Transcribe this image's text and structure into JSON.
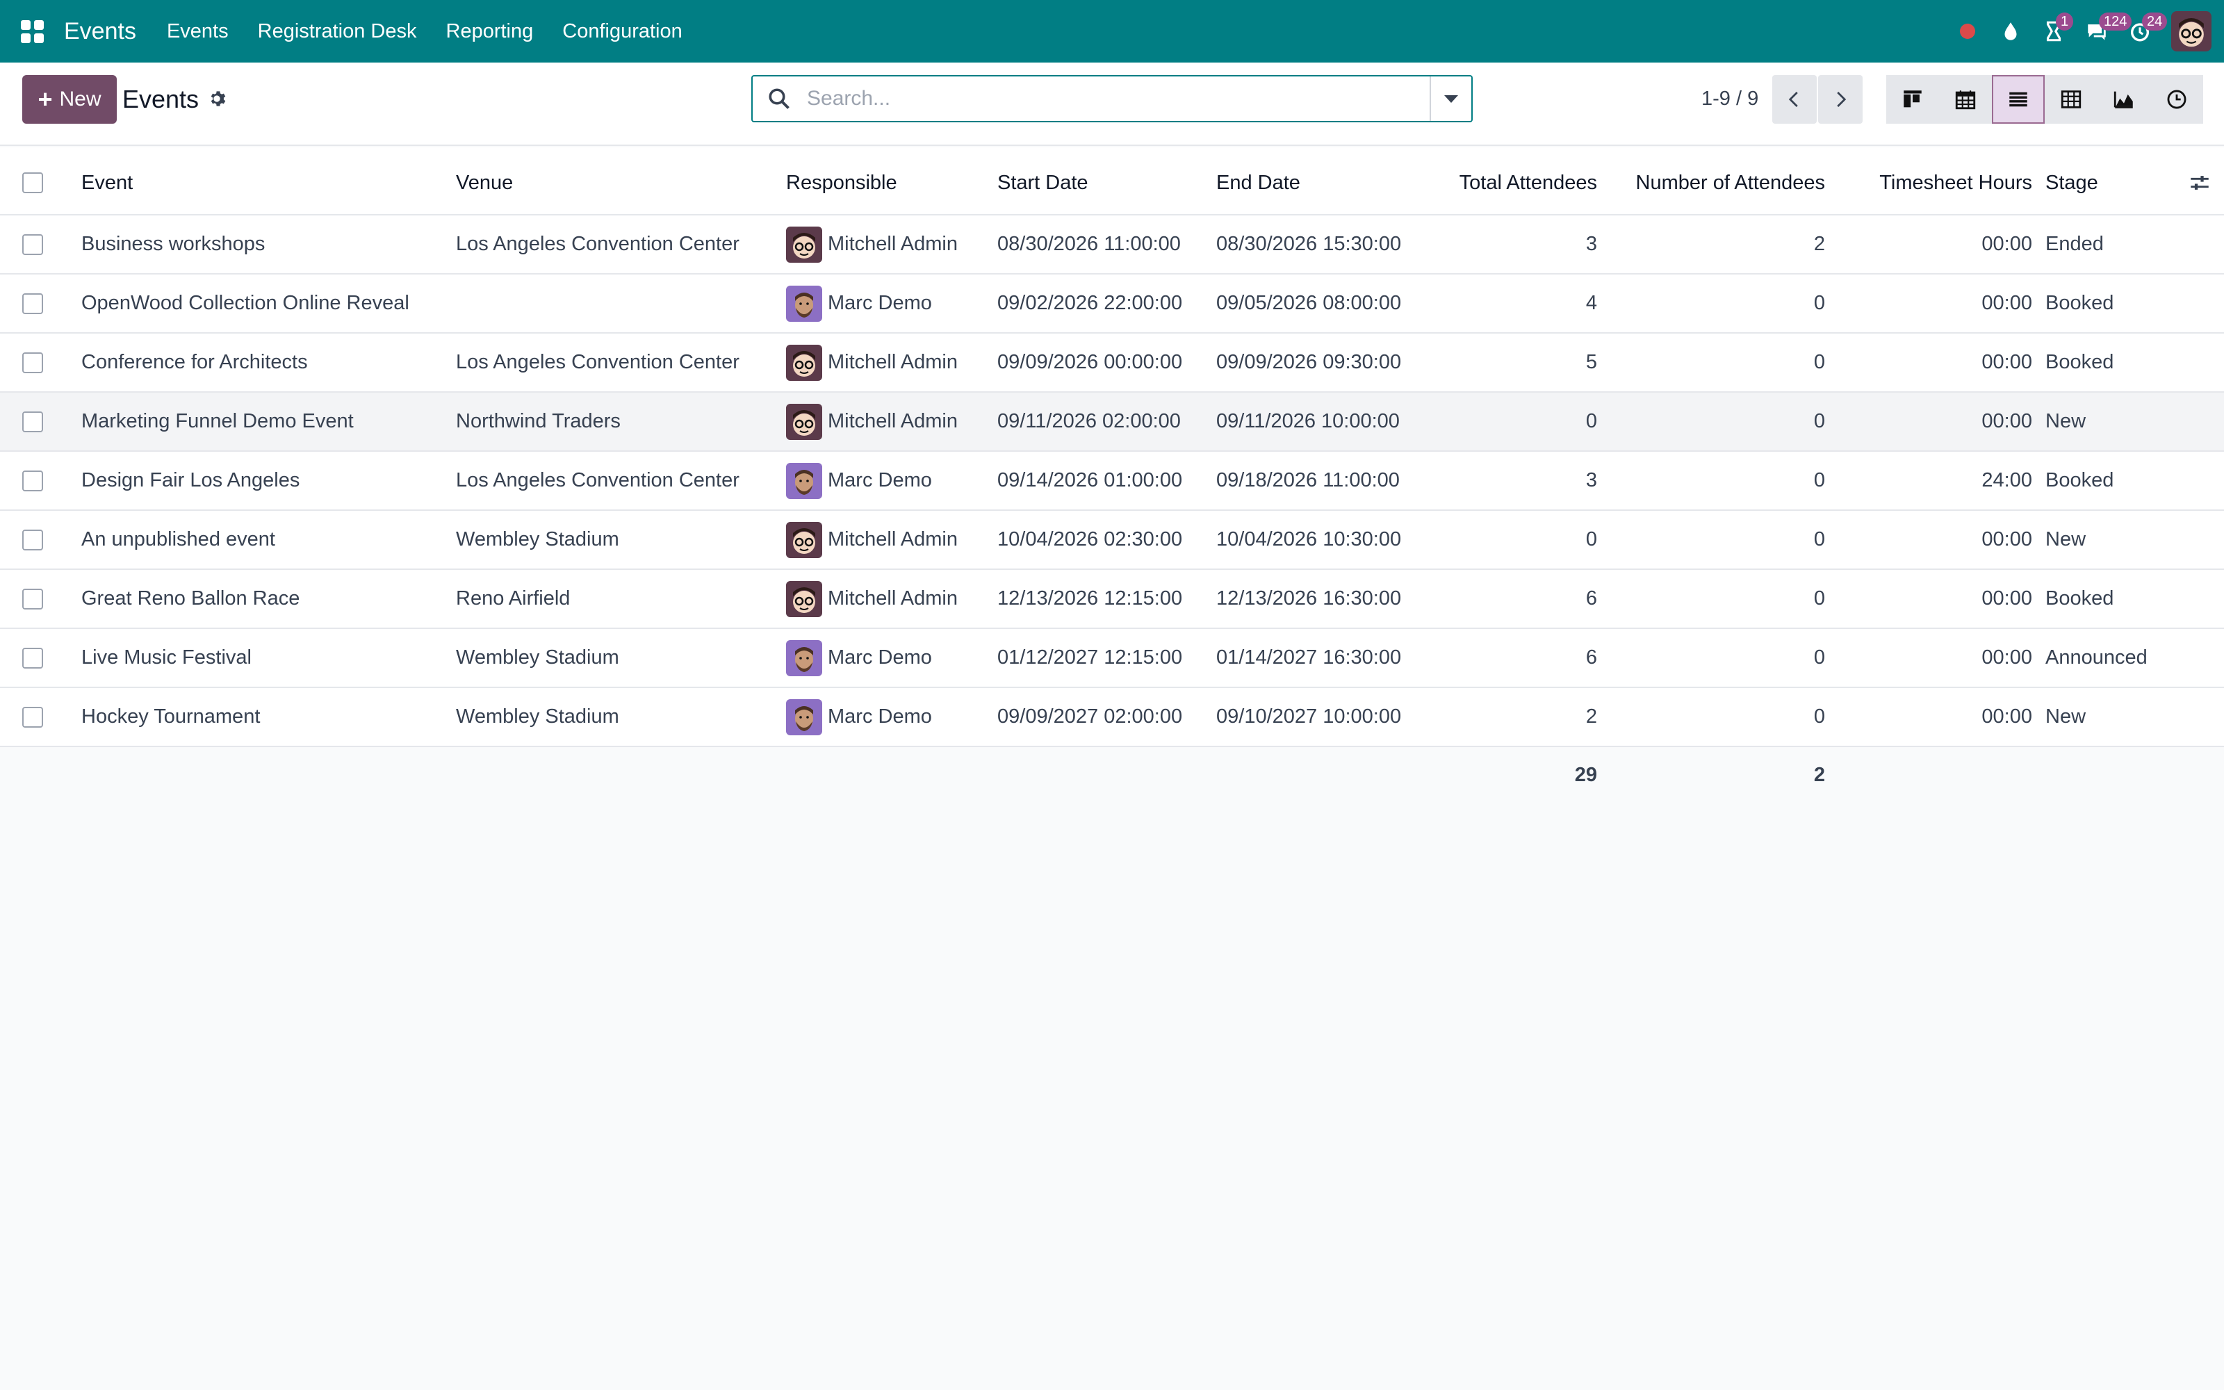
{
  "nav": {
    "brand": "Events",
    "menu": [
      "Events",
      "Registration Desk",
      "Reporting",
      "Configuration"
    ],
    "badges": {
      "activities": "1",
      "messages": "124",
      "timer": "24"
    }
  },
  "control": {
    "new_label": "New",
    "title": "Events",
    "search_placeholder": "Search...",
    "pager": "1-9 / 9"
  },
  "table": {
    "headers": {
      "event": "Event",
      "venue": "Venue",
      "responsible": "Responsible",
      "start": "Start Date",
      "end": "End Date",
      "total": "Total Attendees",
      "number": "Number of Attendees",
      "hours": "Timesheet Hours",
      "stage": "Stage"
    },
    "rows": [
      {
        "event": "Business workshops",
        "venue": "Los Angeles Convention Center",
        "responsible": "Mitchell Admin",
        "avatar": "mitchell",
        "start": "08/30/2026 11:00:00",
        "end": "08/30/2026 15:30:00",
        "total": "3",
        "number": "2",
        "hours": "00:00",
        "stage": "Ended"
      },
      {
        "event": "OpenWood Collection Online Reveal",
        "venue": "",
        "responsible": "Marc Demo",
        "avatar": "marc",
        "start": "09/02/2026 22:00:00",
        "end": "09/05/2026 08:00:00",
        "total": "4",
        "number": "0",
        "hours": "00:00",
        "stage": "Booked"
      },
      {
        "event": "Conference for Architects",
        "venue": "Los Angeles Convention Center",
        "responsible": "Mitchell Admin",
        "avatar": "mitchell",
        "start": "09/09/2026 00:00:00",
        "end": "09/09/2026 09:30:00",
        "total": "5",
        "number": "0",
        "hours": "00:00",
        "stage": "Booked"
      },
      {
        "event": "Marketing Funnel Demo Event",
        "venue": "Northwind Traders",
        "responsible": "Mitchell Admin",
        "avatar": "mitchell",
        "start": "09/11/2026 02:00:00",
        "end": "09/11/2026 10:00:00",
        "total": "0",
        "number": "0",
        "hours": "00:00",
        "stage": "New"
      },
      {
        "event": "Design Fair Los Angeles",
        "venue": "Los Angeles Convention Center",
        "responsible": "Marc Demo",
        "avatar": "marc",
        "start": "09/14/2026 01:00:00",
        "end": "09/18/2026 11:00:00",
        "total": "3",
        "number": "0",
        "hours": "24:00",
        "stage": "Booked"
      },
      {
        "event": "An unpublished event",
        "venue": "Wembley Stadium",
        "responsible": "Mitchell Admin",
        "avatar": "mitchell",
        "start": "10/04/2026 02:30:00",
        "end": "10/04/2026 10:30:00",
        "total": "0",
        "number": "0",
        "hours": "00:00",
        "stage": "New"
      },
      {
        "event": "Great Reno Ballon Race",
        "venue": "Reno Airfield",
        "responsible": "Mitchell Admin",
        "avatar": "mitchell",
        "start": "12/13/2026 12:15:00",
        "end": "12/13/2026 16:30:00",
        "total": "6",
        "number": "0",
        "hours": "00:00",
        "stage": "Booked"
      },
      {
        "event": "Live Music Festival",
        "venue": "Wembley Stadium",
        "responsible": "Marc Demo",
        "avatar": "marc",
        "start": "01/12/2027 12:15:00",
        "end": "01/14/2027 16:30:00",
        "total": "6",
        "number": "0",
        "hours": "00:00",
        "stage": "Announced"
      },
      {
        "event": "Hockey Tournament",
        "venue": "Wembley Stadium",
        "responsible": "Marc Demo",
        "avatar": "marc",
        "start": "09/09/2027 02:00:00",
        "end": "09/10/2027 10:00:00",
        "total": "2",
        "number": "0",
        "hours": "00:00",
        "stage": "New"
      }
    ],
    "totals": {
      "total": "29",
      "number": "2"
    },
    "highlighted_row": 3
  },
  "colors": {
    "navbar": "#017e84",
    "primary": "#714b67",
    "badge": "#9b4b8f"
  }
}
